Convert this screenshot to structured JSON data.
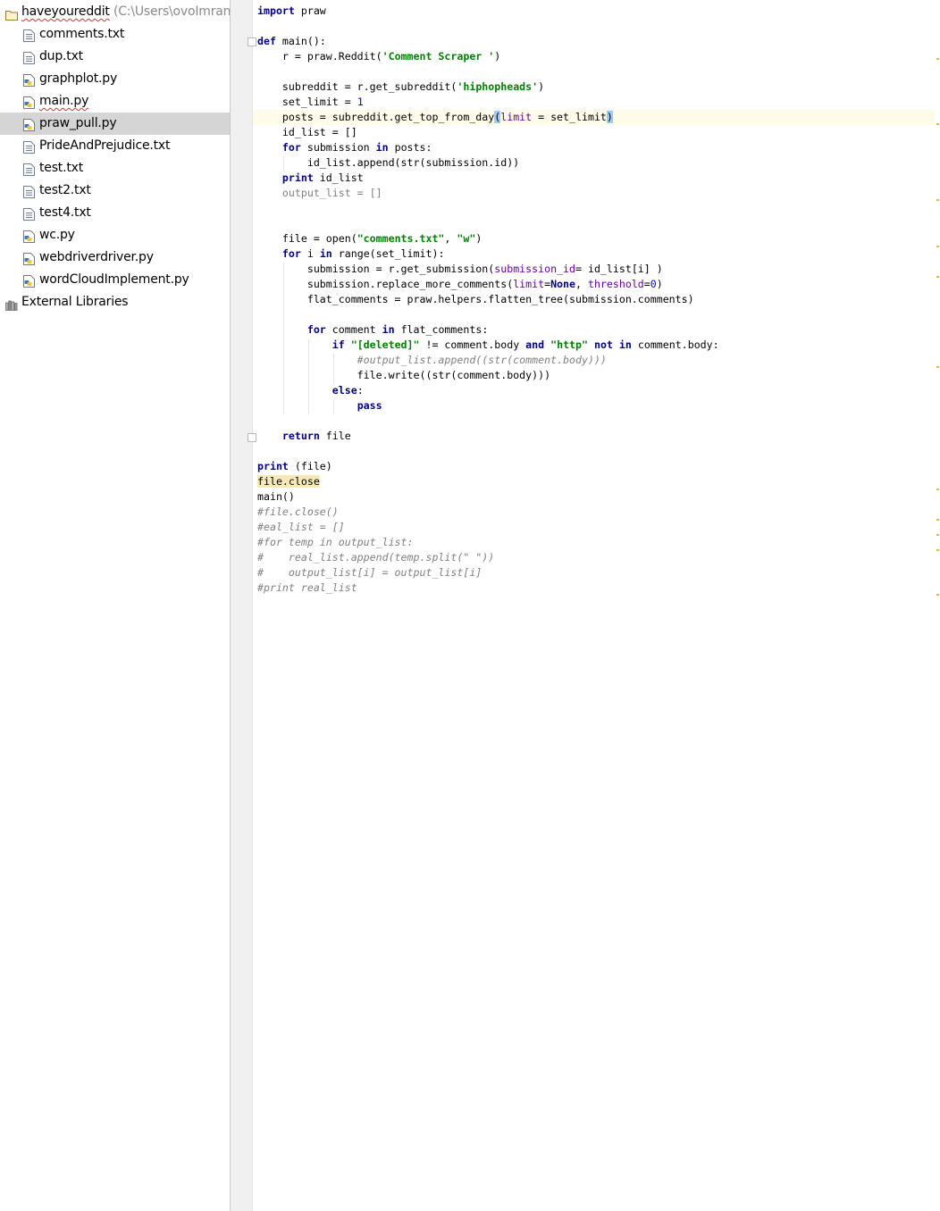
{
  "project": {
    "root": {
      "name": "haveyoureddit",
      "path": "(C:\\Users\\ovoImran\\"
    },
    "files": [
      {
        "name": "comments.txt",
        "type": "txt"
      },
      {
        "name": "dup.txt",
        "type": "txt"
      },
      {
        "name": "graphplot.py",
        "type": "py"
      },
      {
        "name": "main.py",
        "type": "py"
      },
      {
        "name": "praw_pull.py",
        "type": "py",
        "selected": true
      },
      {
        "name": "PrideAndPrejudice.txt",
        "type": "txt"
      },
      {
        "name": "test.txt",
        "type": "txt"
      },
      {
        "name": "test2.txt",
        "type": "txt"
      },
      {
        "name": "test4.txt",
        "type": "txt"
      },
      {
        "name": "wc.py",
        "type": "py"
      },
      {
        "name": "webdriverdriver.py",
        "type": "py"
      },
      {
        "name": "wordCloudImplement.py",
        "type": "py"
      }
    ],
    "external": {
      "name": "External Libraries",
      "icon": "library-icon"
    }
  },
  "editor": {
    "file": "praw_pull.py",
    "lines": [
      "import praw",
      "",
      "def main():",
      "    r = praw.Reddit('Comment Scraper ')",
      "",
      "    subreddit = r.get_subreddit('hiphopheads')",
      "    set_limit = 1",
      "    posts = subreddit.get_top_from_day(limit = set_limit)",
      "    id_list = []",
      "    for submission in posts:",
      "        id_list.append(str(submission.id))",
      "    print id_list",
      "    output_list = []",
      "",
      "",
      "    file = open(\"comments.txt\", \"w\")",
      "    for i in range(set_limit):",
      "        submission = r.get_submission(submission_id= id_list[i] )",
      "        submission.replace_more_comments(limit=None, threshold=0)",
      "        flat_comments = praw.helpers.flatten_tree(submission.comments)",
      "",
      "        for comment in flat_comments:",
      "            if \"[deleted]\" != comment.body and \"http\" not in comment.body:",
      "                #output_list.append((str(comment.body)))",
      "                file.write((str(comment.body)))",
      "            else:",
      "                pass",
      "",
      "    return file",
      "",
      "print (file)",
      "file.close",
      "main()",
      "#file.close()",
      "#eal_list = []",
      "#for temp in output_list:",
      "#    real_list.append(temp.split(\" \"))",
      "#    output_list[i] = output_list[i]",
      "#print real_list"
    ]
  },
  "colors": {
    "keyword": "#000080",
    "string": "#008000",
    "number": "#0000ff",
    "kwarg": "#660099",
    "comment": "#808080",
    "selection": "#d5d5d5",
    "current_line": "#fefce8"
  }
}
